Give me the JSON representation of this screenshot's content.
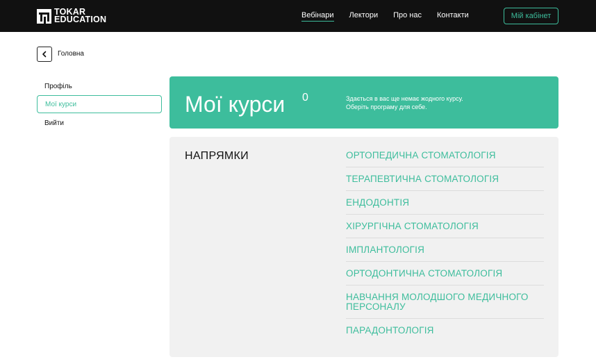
{
  "brand": {
    "line1": "TOKAR",
    "line2": "EDUCATION",
    "accent": "#3dbd9c"
  },
  "nav": [
    {
      "label": "Вебінари",
      "active": true
    },
    {
      "label": "Лектори"
    },
    {
      "label": "Про нас"
    },
    {
      "label": "Контакти"
    }
  ],
  "header": {
    "cabinet_label": "Мій кабінет"
  },
  "breadcrumb": {
    "back_icon": "chevron-left-icon",
    "label": "Головна"
  },
  "sidebar": {
    "items": [
      {
        "label": "Профіль"
      },
      {
        "label": "Мої курси",
        "active": true
      },
      {
        "label": "Вийти"
      }
    ]
  },
  "hero": {
    "title": "Мої курси",
    "count": "0",
    "message_line1": "Здається в вас ще немає жодного курсу.",
    "message_line2": "Оберіть програму для себе."
  },
  "directions": {
    "heading": "НАПРЯМКИ",
    "items": [
      "ОРТОПЕДИЧНА СТОМАТОЛОГІЯ",
      "ТЕРАПЕВТИЧНА СТОМАТОЛОГІЯ",
      "ЕНДОДОНТІЯ",
      "ХІРУРГІЧНА СТОМАТОЛОГІЯ",
      "ІМПЛАНТОЛОГІЯ",
      "ОРТОДОНТИЧНА СТОМАТОЛОГІЯ",
      "НАВЧАННЯ МОЛОДШОГО МЕДИЧНОГО ПЕРСОНАЛУ",
      "ПАРАДОНТОЛОГІЯ"
    ]
  }
}
